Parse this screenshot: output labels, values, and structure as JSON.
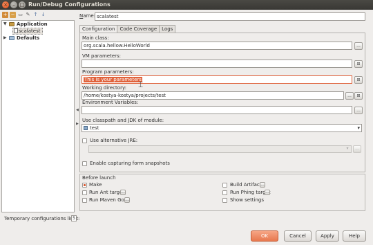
{
  "window": {
    "title": "Run/Debug Configurations"
  },
  "toolbar": {
    "icons": [
      "add-icon",
      "remove-icon",
      "copy-icon",
      "settings-icon",
      "move-up-icon",
      "move-down-icon"
    ],
    "add": "+",
    "remove": "−",
    "copy": "▭",
    "settings": "✎",
    "up": "↑",
    "down": "↓"
  },
  "tree": {
    "application": {
      "arrow": "▼",
      "label": "Application"
    },
    "scalatest": {
      "label": "scalatest"
    },
    "defaults": {
      "arrow": "▶",
      "label": "Defaults"
    }
  },
  "temp_limit": {
    "label": "Temporary configurations limit:",
    "value": "5"
  },
  "name": {
    "label": "Name:",
    "value": "scalatest"
  },
  "tabs": [
    "Configuration",
    "Code Coverage",
    "Logs"
  ],
  "form": {
    "main_class": {
      "label": "Main class:",
      "value": "org.scala.hellow.HelloWorld"
    },
    "vm_params": {
      "label": "VM parameters:",
      "value": ""
    },
    "program_params": {
      "label": "Program parameters:",
      "value": "This is your parameters"
    },
    "working_dir": {
      "label": "Working directory:",
      "value": "/home/kostya-kostya/projects/test"
    },
    "env_vars": {
      "label": "Environment Variables:",
      "value": ""
    },
    "classpath": {
      "label": "Use classpath and JDK of module:",
      "value": "test"
    },
    "alt_jre": {
      "label": "Use alternative JRE:",
      "checked": false
    },
    "snapshots": {
      "label": "Enable capturing form snapshots",
      "checked": false
    },
    "dots_button": "...",
    "expand_button": "⊞",
    "dropdown_arrow": "▾"
  },
  "before_launch": {
    "title": "Before launch",
    "items": [
      {
        "label": "Make",
        "checked": true
      },
      {
        "label": "Run Ant target",
        "checked": false
      },
      {
        "label": "Run Maven Goal",
        "checked": false
      },
      {
        "label": "Build Artifacts",
        "checked": false
      },
      {
        "label": "Run Phing target",
        "checked": false
      },
      {
        "label": "Show settings",
        "checked": false
      }
    ]
  },
  "buttons": {
    "ok": "OK",
    "cancel": "Cancel",
    "apply": "Apply",
    "help": "Help"
  },
  "colors": {
    "accent": "#e8784e",
    "selection": "#e0613a",
    "background": "#efedeb"
  }
}
